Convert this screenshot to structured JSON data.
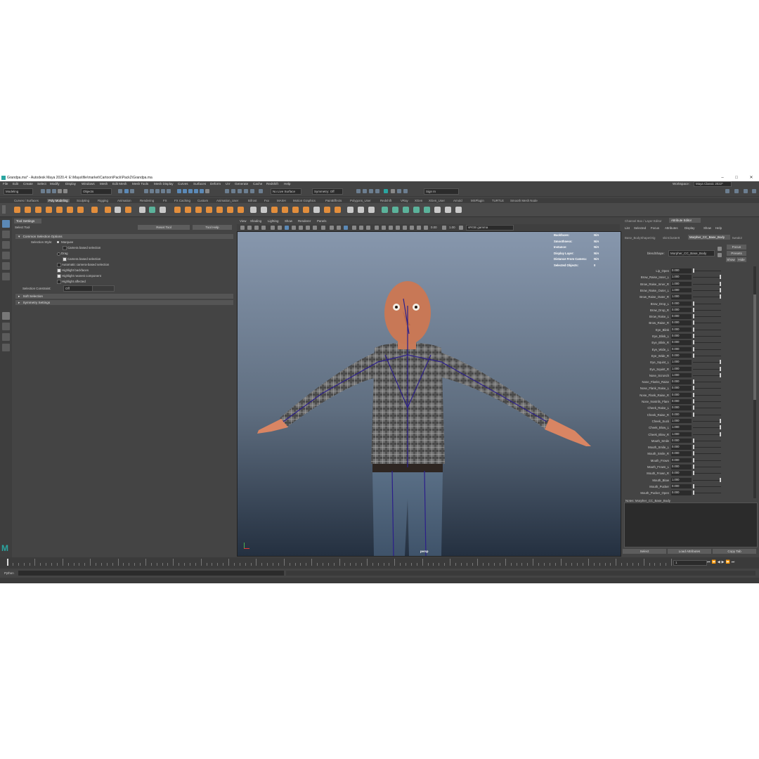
{
  "window": {
    "title": "Grandpa.ma* - Autodesk Maya 2020.4: E:\\Maya\\file\\market\\Cartoon\\Pack\\Pack2\\Grandpa.ma",
    "minimize": "–",
    "maximize": "□",
    "close": "✕"
  },
  "menubar": [
    "File",
    "Edit",
    "Create",
    "Select",
    "Modify",
    "Display",
    "Windows",
    "Mesh",
    "Edit Mesh",
    "Mesh Tools",
    "Mesh Display",
    "Curves",
    "Surfaces",
    "Deform",
    "UV",
    "Generate",
    "Cache",
    "Redshift",
    "Help"
  ],
  "workspace": {
    "label": "Workspace :",
    "value": "Maya Classic 2022*"
  },
  "statusline": {
    "mode": "Modeling",
    "objects": "Objects",
    "live_surface": "No Live Surface",
    "symmetry": "Symmetry: Off",
    "sign_in": "Sign In"
  },
  "shelf_tabs": [
    "Curves / Surfaces",
    "Poly Modeling",
    "Sculpting",
    "Rigging",
    "Animation",
    "Rendering",
    "FX",
    "FX Caching",
    "Custom",
    "Animation_User",
    "Bifrost",
    "Fxx",
    "MASH",
    "Motion Graphics",
    "PaintEffects",
    "Polygons_User",
    "Redshift",
    "VRay",
    "XGen",
    "XGen_User",
    "Arnold",
    "MSPlugin",
    "TURTLE",
    "Smooth Mesh Node"
  ],
  "shelf_active": "Poly Modeling",
  "tool_settings": {
    "panel_title": "Tool Settings",
    "tool_name": "Select Tool",
    "reset": "Reset Tool",
    "help": "Tool Help",
    "section1": "Common Selection Options",
    "selection_style_label": "Selection Style:",
    "marquee": "Marquee",
    "camera_based_1": "Camera based selection",
    "drag": "Drag",
    "camera_based_2": "Camera based selection",
    "auto_camera": "Automatic camera-based selection",
    "highlight_backfaces": "Highlight backfaces",
    "highlight_nearest": "Highlight nearest component",
    "highlight_affected": "Highlight affected",
    "constraint_label": "Selection Constraint:",
    "constraint_value": "Off",
    "section2": "Soft Selection",
    "section3": "Symmetry Settings"
  },
  "viewport": {
    "menu": [
      "View",
      "Shading",
      "Lighting",
      "Show",
      "Renderer",
      "Panels"
    ],
    "exposure": "0.00",
    "gamma": "1.00",
    "colorspace": "sRGB gamma",
    "camera": "persp",
    "hud": [
      {
        "label": "Backfaces:",
        "value": "N/A"
      },
      {
        "label": "Smoothness:",
        "value": "N/A"
      },
      {
        "label": "Instance:",
        "value": "N/A"
      },
      {
        "label": "Display Layer:",
        "value": "N/A"
      },
      {
        "label": "Distance From Camera:",
        "value": "N/A"
      },
      {
        "label": "Selected Objects:",
        "value": "0"
      }
    ]
  },
  "right_panel": {
    "tabs": [
      "Channel Box / Layer Editor",
      "Attribute Editor"
    ],
    "menu": [
      "List",
      "Selected",
      "Focus",
      "Attributes",
      "Display",
      "Show",
      "Help"
    ],
    "node_tabs": [
      "Base_BodyShapeOrig",
      "skinCluster8",
      "Morpher_CC_Base_Body",
      "tweak2"
    ],
    "blendshape_label": "blendShape:",
    "blendshape_value": "Morpher_CC_Base_Body",
    "focus": "Focus",
    "presets": "Presets",
    "show": "Show",
    "hide": "Hide",
    "attributes": [
      {
        "name": "Lip_Open",
        "value": "0.000"
      },
      {
        "name": "Brow_Raise_Inner_L",
        "value": "1.000"
      },
      {
        "name": "Brow_Raise_Inner_R",
        "value": "1.000"
      },
      {
        "name": "Brow_Raise_Outer_L",
        "value": "1.000"
      },
      {
        "name": "Brow_Raise_Outer_R",
        "value": "1.000"
      },
      {
        "name": "Brow_Drop_L",
        "value": "0.000"
      },
      {
        "name": "Brow_Drop_R",
        "value": "0.000"
      },
      {
        "name": "Brow_Raise_L",
        "value": "0.000"
      },
      {
        "name": "Brow_Raise_R",
        "value": "0.000"
      },
      {
        "name": "Eye_Blink",
        "value": "0.000"
      },
      {
        "name": "Eye_Blink_L",
        "value": "0.000"
      },
      {
        "name": "Eye_Blink_R",
        "value": "0.000"
      },
      {
        "name": "Eye_Wide_L",
        "value": "0.000"
      },
      {
        "name": "Eye_Wide_R",
        "value": "0.000"
      },
      {
        "name": "Eye_Squint_L",
        "value": "1.000"
      },
      {
        "name": "Eye_Squint_R",
        "value": "1.000"
      },
      {
        "name": "Nose_Scrunch",
        "value": "1.000"
      },
      {
        "name": "Nose_Flanks_Raise",
        "value": "0.000"
      },
      {
        "name": "Nose_Flank_Raise_L",
        "value": "0.000"
      },
      {
        "name": "Nose_Flank_Raise_R",
        "value": "0.000"
      },
      {
        "name": "Nose_Nostrils_Flare",
        "value": "0.000"
      },
      {
        "name": "Cheek_Raise_L",
        "value": "0.000"
      },
      {
        "name": "Cheek_Raise_R",
        "value": "0.000"
      },
      {
        "name": "Cheek_Suck",
        "value": "1.000"
      },
      {
        "name": "Cheek_Blow_L",
        "value": "1.000"
      },
      {
        "name": "Cheek_Blow_R",
        "value": "1.000"
      },
      {
        "name": "Mouth_Smile",
        "value": "0.000"
      },
      {
        "name": "Mouth_Smile_L",
        "value": "0.000"
      },
      {
        "name": "Mouth_Smile_R",
        "value": "0.000"
      },
      {
        "name": "Mouth_Frown",
        "value": "0.000"
      },
      {
        "name": "Mouth_Frown_L",
        "value": "0.000"
      },
      {
        "name": "Mouth_Frown_R",
        "value": "0.000"
      },
      {
        "name": "Mouth_Blow",
        "value": "1.000"
      },
      {
        "name": "Mouth_Pucker",
        "value": "0.000"
      },
      {
        "name": "Mouth_Pucker_Open",
        "value": "0.000"
      }
    ],
    "notes_label": "Notes: Morpher_CC_Base_Body",
    "select": "Select",
    "load_attributes": "Load Attributes",
    "copy_tab": "Copy Tab"
  },
  "timeline": {
    "current_frame": "1"
  },
  "command_line": {
    "language": "Python"
  },
  "colors": {
    "ui_bg": "#444444",
    "accent": "#5b89b7",
    "shelf_icon": "#e38e3c",
    "viewport_top": "#8797ad",
    "viewport_bottom": "#243040"
  }
}
